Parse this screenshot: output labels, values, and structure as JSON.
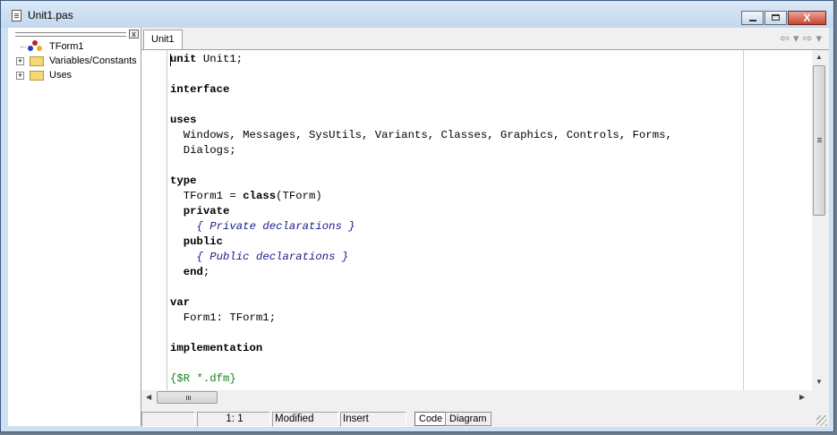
{
  "window": {
    "title": "Unit1.pas",
    "close_glyph": "X"
  },
  "explorer": {
    "close_glyph": "x",
    "items": [
      {
        "label": "TForm1",
        "expander": ""
      },
      {
        "label": "Variables/Constants",
        "expander": "+"
      },
      {
        "label": "Uses",
        "expander": "+"
      }
    ]
  },
  "tabs": [
    {
      "label": "Unit1"
    }
  ],
  "nav": {
    "back": "⇦",
    "back_dropdown": "▾",
    "forward": "⇨",
    "forward_dropdown": "▾"
  },
  "code_lines": [
    [
      {
        "t": "unit",
        "k": "kw"
      },
      {
        "t": " Unit1;"
      }
    ],
    [],
    [
      {
        "t": "interface",
        "k": "kw"
      }
    ],
    [],
    [
      {
        "t": "uses",
        "k": "kw"
      }
    ],
    [
      {
        "t": "  Windows, Messages, SysUtils, Variants, Classes, Graphics, Controls, Forms,"
      }
    ],
    [
      {
        "t": "  Dialogs;"
      }
    ],
    [],
    [
      {
        "t": "type",
        "k": "kw"
      }
    ],
    [
      {
        "t": "  TForm1 = "
      },
      {
        "t": "class",
        "k": "kw"
      },
      {
        "t": "(TForm)"
      }
    ],
    [
      {
        "t": "  "
      },
      {
        "t": "private",
        "k": "kw"
      }
    ],
    [
      {
        "t": "    "
      },
      {
        "t": "{ Private declarations }",
        "k": "cm"
      }
    ],
    [
      {
        "t": "  "
      },
      {
        "t": "public",
        "k": "kw"
      }
    ],
    [
      {
        "t": "    "
      },
      {
        "t": "{ Public declarations }",
        "k": "cm"
      }
    ],
    [
      {
        "t": "  "
      },
      {
        "t": "end",
        "k": "kw"
      },
      {
        "t": ";"
      }
    ],
    [],
    [
      {
        "t": "var",
        "k": "kw"
      }
    ],
    [
      {
        "t": "  Form1: TForm1;"
      }
    ],
    [],
    [
      {
        "t": "implementation",
        "k": "kw"
      }
    ],
    [],
    [
      {
        "t": "{$R *.dfm}",
        "k": "dir"
      }
    ]
  ],
  "status": {
    "empty": "",
    "position": "1:  1",
    "modified": "Modified",
    "mode": "Insert",
    "code_tab": "Code",
    "diagram_tab": "Diagram"
  },
  "scroll_glyphs": {
    "up": "▲",
    "down": "▼",
    "left": "◀",
    "right": "▶"
  }
}
